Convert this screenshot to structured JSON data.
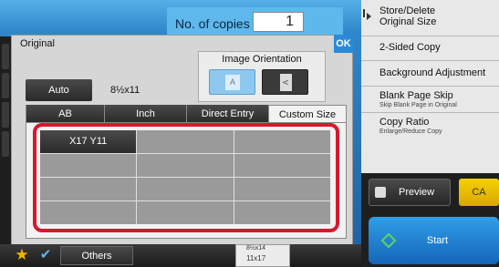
{
  "header": {
    "copies_label": "No. of copies",
    "copies_value": "1"
  },
  "right_panel": {
    "items": [
      {
        "label": "Store/Delete",
        "label2": "Original Size"
      },
      {
        "label": "2-Sided Copy"
      },
      {
        "label": "Background Adjustment"
      },
      {
        "label": "Blank Page Skip",
        "sub": "Skip Blank Page in Original"
      },
      {
        "label": "Copy Ratio",
        "sub": "Enlarge/Reduce Copy"
      }
    ],
    "preview_label": "Preview",
    "ca_label": "CA",
    "start_label": "Start"
  },
  "dialog": {
    "title": "Original",
    "ok_label": "OK",
    "orientation_label": "Image Orientation",
    "orientation_a_glyph": "A",
    "orientation_b_glyph": "A",
    "auto_label": "Auto",
    "auto_size": "8½x11",
    "tabs": [
      {
        "label": "AB",
        "active": false
      },
      {
        "label": "Inch",
        "active": false
      },
      {
        "label": "Direct Entry",
        "active": false
      },
      {
        "label": "Custom Size",
        "active": true
      }
    ],
    "custom_sizes": [
      "X17 Y11",
      "",
      "",
      "",
      "",
      "",
      "",
      "",
      "",
      "",
      "",
      ""
    ]
  },
  "bottom_bar": {
    "others_label": "Others",
    "paper_line1": "8½x14",
    "paper_line2": "11x17"
  },
  "colors": {
    "accent_blue": "#2a8ad8",
    "highlight_red": "#d6182d",
    "ca_yellow": "#f5d000",
    "start_blue": "#1f7fd0"
  },
  "icons": {
    "favorite": "star-icon",
    "check": "check-icon",
    "preview": "preview-icon",
    "start": "start-icon"
  }
}
